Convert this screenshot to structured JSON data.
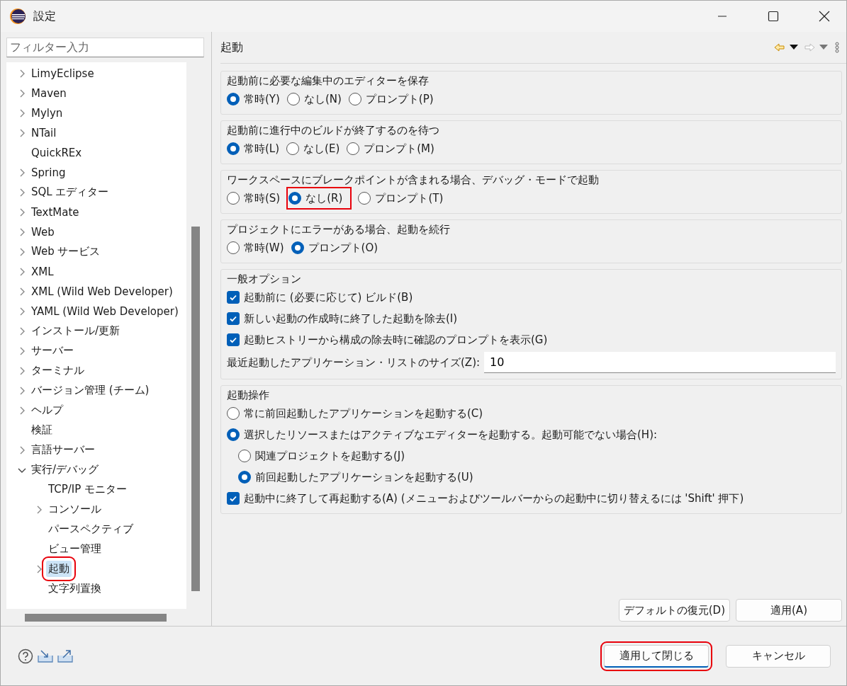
{
  "window": {
    "title": "設定"
  },
  "filter": {
    "placeholder": "フィルター入力"
  },
  "tree": [
    {
      "label": "LimyEclipse",
      "kind": "branch",
      "expanded": false,
      "selected": false,
      "highlighted": false
    },
    {
      "label": "Maven",
      "kind": "branch",
      "expanded": false,
      "selected": false,
      "highlighted": false
    },
    {
      "label": "Mylyn",
      "kind": "branch",
      "expanded": false,
      "selected": false,
      "highlighted": false
    },
    {
      "label": "NTail",
      "kind": "branch",
      "expanded": false,
      "selected": false,
      "highlighted": false
    },
    {
      "label": "QuickREx",
      "kind": "leaf",
      "selected": false,
      "highlighted": false
    },
    {
      "label": "Spring",
      "kind": "branch",
      "expanded": false,
      "selected": false,
      "highlighted": false
    },
    {
      "label": "SQL エディター",
      "kind": "branch",
      "expanded": false,
      "selected": false,
      "highlighted": false
    },
    {
      "label": "TextMate",
      "kind": "branch",
      "expanded": false,
      "selected": false,
      "highlighted": false
    },
    {
      "label": "Web",
      "kind": "branch",
      "expanded": false,
      "selected": false,
      "highlighted": false
    },
    {
      "label": "Web サービス",
      "kind": "branch",
      "expanded": false,
      "selected": false,
      "highlighted": false
    },
    {
      "label": "XML",
      "kind": "branch",
      "expanded": false,
      "selected": false,
      "highlighted": false
    },
    {
      "label": "XML (Wild Web Developer)",
      "kind": "branch",
      "expanded": false,
      "selected": false,
      "highlighted": false
    },
    {
      "label": "YAML (Wild Web Developer)",
      "kind": "branch",
      "expanded": false,
      "selected": false,
      "highlighted": false
    },
    {
      "label": "インストール/更新",
      "kind": "branch",
      "expanded": false,
      "selected": false,
      "highlighted": false
    },
    {
      "label": "サーバー",
      "kind": "branch",
      "expanded": false,
      "selected": false,
      "highlighted": false
    },
    {
      "label": "ターミナル",
      "kind": "branch",
      "expanded": false,
      "selected": false,
      "highlighted": false
    },
    {
      "label": "バージョン管理 (チーム)",
      "kind": "branch",
      "expanded": false,
      "selected": false,
      "highlighted": false
    },
    {
      "label": "ヘルプ",
      "kind": "branch",
      "expanded": false,
      "selected": false,
      "highlighted": false
    },
    {
      "label": "検証",
      "kind": "leaf",
      "selected": false,
      "highlighted": false
    },
    {
      "label": "言語サーバー",
      "kind": "branch",
      "expanded": false,
      "selected": false,
      "highlighted": false
    },
    {
      "label": "実行/デバッグ",
      "kind": "branch",
      "expanded": true,
      "selected": false,
      "highlighted": false,
      "children": [
        {
          "label": "TCP/IP モニター",
          "kind": "leaf",
          "selected": false,
          "highlighted": false
        },
        {
          "label": "コンソール",
          "kind": "branch",
          "expanded": false,
          "selected": false,
          "highlighted": false
        },
        {
          "label": "パースペクティブ",
          "kind": "leaf",
          "selected": false,
          "highlighted": false
        },
        {
          "label": "ビュー管理",
          "kind": "leaf",
          "selected": false,
          "highlighted": false
        },
        {
          "label": "起動",
          "kind": "branch",
          "expanded": false,
          "selected": true,
          "highlighted": true
        },
        {
          "label": "文字列置換",
          "kind": "leaf",
          "selected": false,
          "highlighted": false
        }
      ]
    }
  ],
  "page": {
    "title": "起動"
  },
  "groups": [
    {
      "title": "起動前に必要な編集中のエディターを保存",
      "items": [
        {
          "kind": "radio",
          "label": "常時(Y)",
          "selected": true,
          "highlighted": false
        },
        {
          "kind": "radio",
          "label": "なし(N)",
          "selected": false,
          "highlighted": false
        },
        {
          "kind": "radio",
          "label": "プロンプト(P)",
          "selected": false,
          "highlighted": false
        }
      ]
    },
    {
      "title": "起動前に進行中のビルドが終了するのを待つ",
      "items": [
        {
          "kind": "radio",
          "label": "常時(L)",
          "selected": true,
          "highlighted": false
        },
        {
          "kind": "radio",
          "label": "なし(E)",
          "selected": false,
          "highlighted": false
        },
        {
          "kind": "radio",
          "label": "プロンプト(M)",
          "selected": false,
          "highlighted": false
        }
      ]
    },
    {
      "title": "ワークスペースにブレークポイントが含まれる場合、デバッグ・モードで起動",
      "items": [
        {
          "kind": "radio",
          "label": "常時(S)",
          "selected": false,
          "highlighted": false
        },
        {
          "kind": "radio",
          "label": "なし(R)",
          "selected": true,
          "highlighted": true
        },
        {
          "kind": "radio",
          "label": "プロンプト(T)",
          "selected": false,
          "highlighted": false
        }
      ]
    },
    {
      "title": "プロジェクトにエラーがある場合、起動を続行",
      "items": [
        {
          "kind": "radio",
          "label": "常時(W)",
          "selected": false,
          "highlighted": false
        },
        {
          "kind": "radio",
          "label": "プロンプト(O)",
          "selected": true,
          "highlighted": false
        }
      ]
    },
    {
      "title": "一般オプション",
      "items": [
        {
          "kind": "checkbox",
          "label": "起動前に (必要に応じて) ビルド(B)",
          "checked": true
        },
        {
          "kind": "checkbox",
          "label": "新しい起動の作成時に終了した起動を除去(I)",
          "checked": true
        },
        {
          "kind": "checkbox",
          "label": "起動ヒストリーから構成の除去時に確認のプロンプトを表示(G)",
          "checked": true
        },
        {
          "kind": "field",
          "label": "最近起動したアプリケーション・リストのサイズ(Z):",
          "value": "10"
        }
      ]
    },
    {
      "title": "起動操作",
      "items": [
        {
          "kind": "radio",
          "label": "常に前回起動したアプリケーションを起動する(C)",
          "selected": false,
          "highlighted": false
        },
        {
          "kind": "radio",
          "label": "選択したリソースまたはアクティブなエディターを起動する。起動可能でない場合(H):",
          "selected": true,
          "highlighted": false,
          "children": [
            {
              "kind": "radio",
              "label": "関連プロジェクトを起動する(J)",
              "selected": false,
              "highlighted": false
            },
            {
              "kind": "radio",
              "label": "前回起動したアプリケーションを起動する(U)",
              "selected": true,
              "highlighted": false
            }
          ]
        },
        {
          "kind": "checkbox",
          "label": "起動中に終了して再起動する(A) (メニューおよびツールバーからの起動中に切り替えるには 'Shift' 押下)",
          "checked": true
        }
      ]
    }
  ],
  "page_buttons": [
    {
      "label": "デフォルトの復元(D)",
      "highlighted": false
    },
    {
      "label": "適用(A)",
      "highlighted": false
    }
  ],
  "dialog_buttons": [
    {
      "label": "適用して閉じる",
      "highlighted": true
    },
    {
      "label": "キャンセル",
      "highlighted": false
    }
  ]
}
